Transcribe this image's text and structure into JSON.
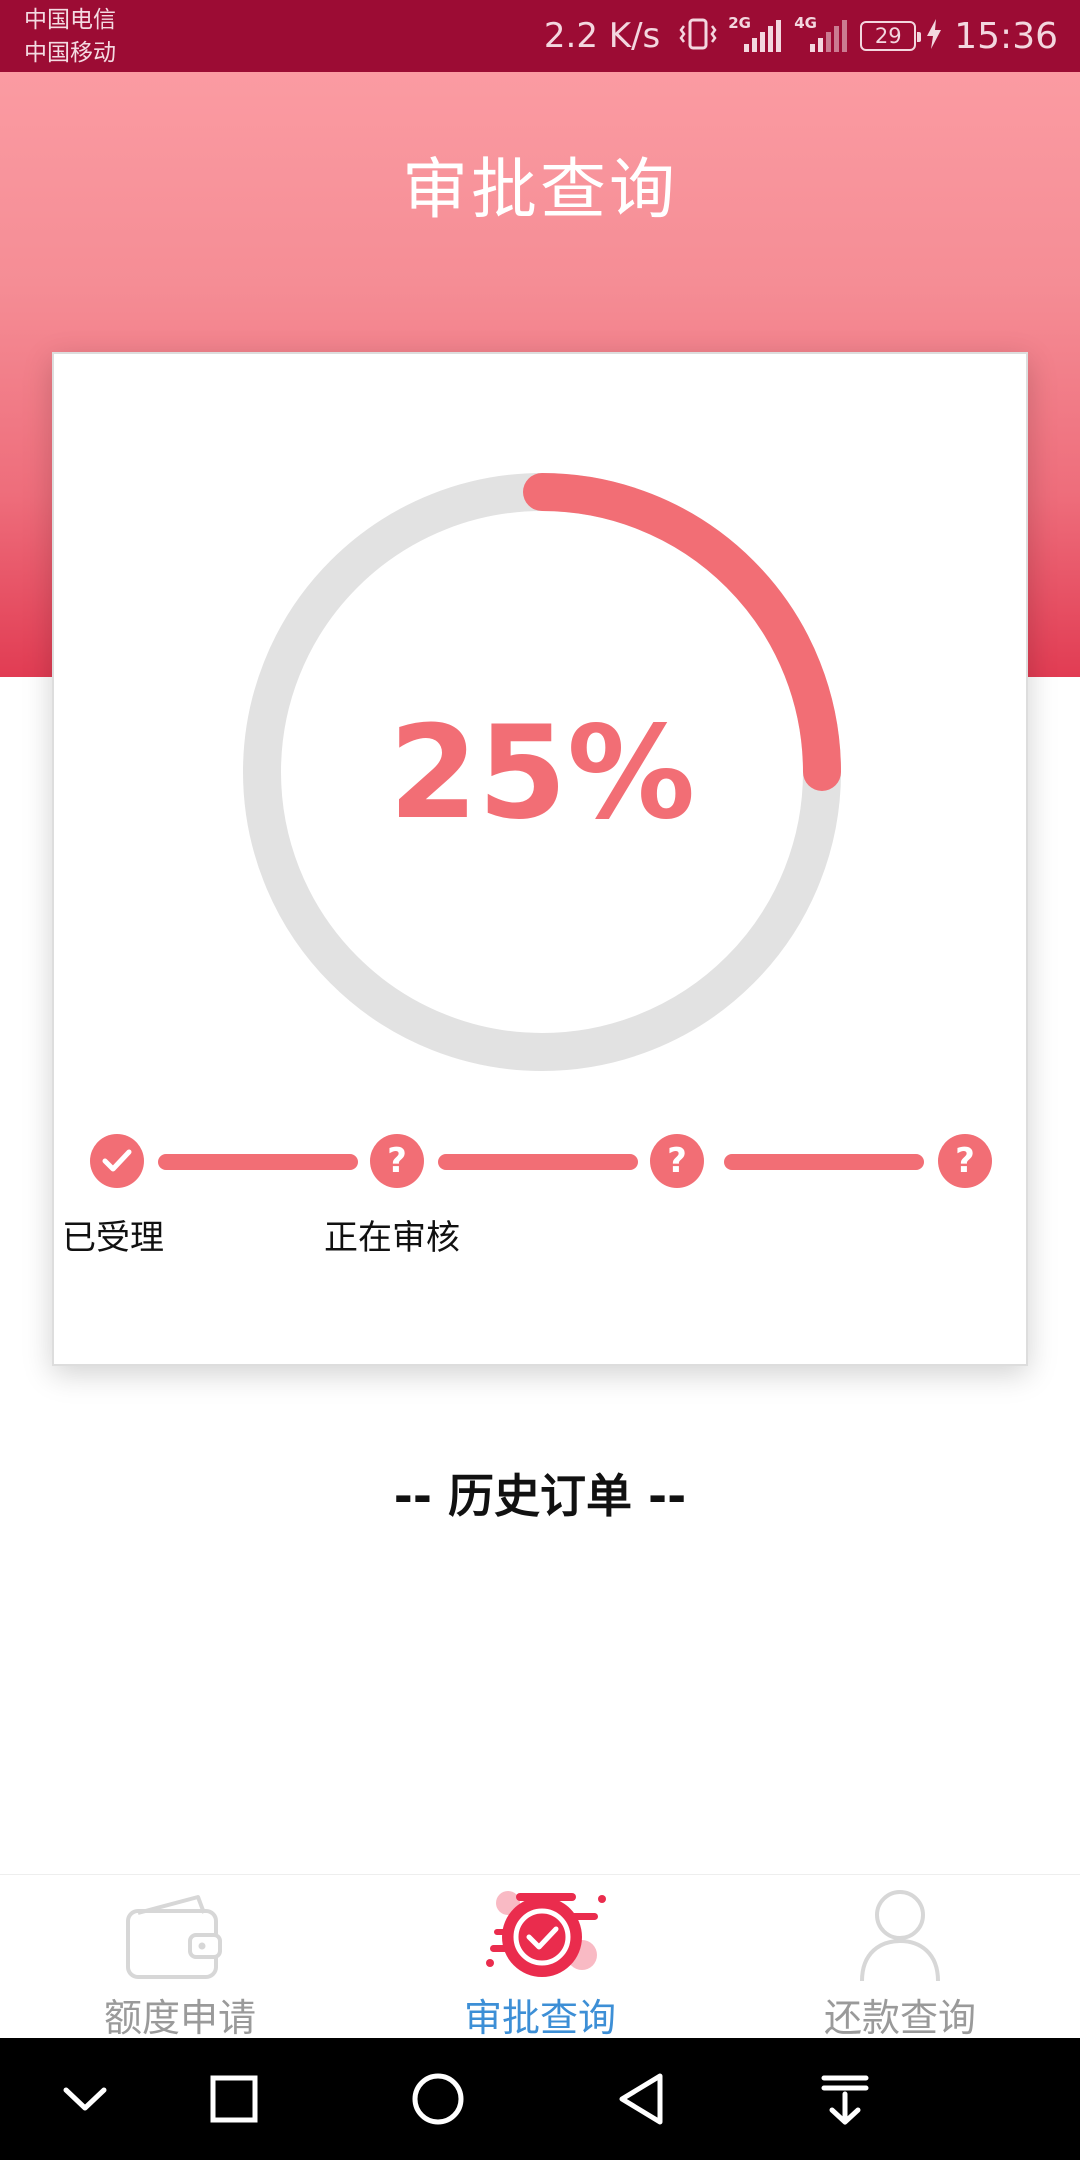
{
  "status_bar": {
    "carrier_1": "中国电信",
    "carrier_2": "中国移动",
    "net_speed": "2.2 K/s",
    "signal_1_label": "2G",
    "signal_2_label": "4G",
    "battery_level": "29",
    "time": "15:36"
  },
  "header": {
    "title": "审批查询"
  },
  "progress": {
    "percent_text": "25%",
    "fraction": 0.25,
    "accent_color": "#f26e75",
    "track_color": "#e2e2e2"
  },
  "steps": [
    {
      "status": "done",
      "icon": "check-icon",
      "label": "已受理"
    },
    {
      "status": "current",
      "icon": "question-icon",
      "label": "正在审核"
    },
    {
      "status": "pending",
      "icon": "question-icon",
      "label": ""
    },
    {
      "status": "pending",
      "icon": "question-icon",
      "label": ""
    }
  ],
  "history": {
    "title": "-- 历史订单 --"
  },
  "tabs": [
    {
      "label": "额度申请",
      "icon": "wallet-icon",
      "active": false
    },
    {
      "label": "审批查询",
      "icon": "approval-check-icon",
      "active": true
    },
    {
      "label": "还款查询",
      "icon": "person-icon",
      "active": false
    }
  ],
  "colors": {
    "status_bar": "#9c0c34",
    "header_top": "#fb9ba2",
    "header_bottom": "#e13c53",
    "active_tab": "#3d8fd6",
    "inactive_tab": "#9a9a9a"
  }
}
